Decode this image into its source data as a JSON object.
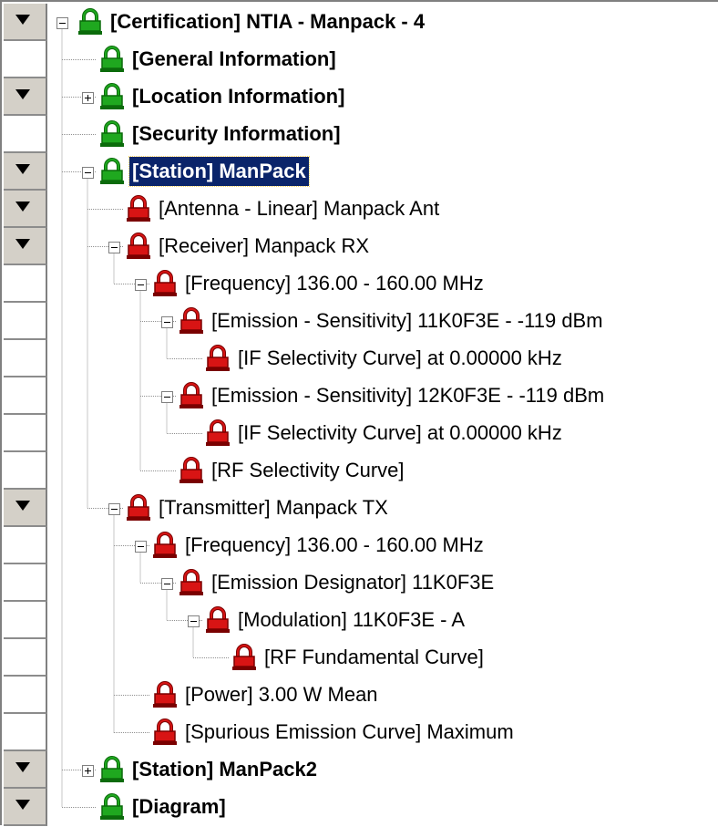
{
  "tree": {
    "nodes": [
      {
        "label": "[Certification] NTIA - Manpack - 4",
        "depth": 0,
        "bold": true,
        "lock": "green",
        "expander": "minus",
        "dropdown": true
      },
      {
        "label": "[General Information]",
        "depth": 1,
        "bold": true,
        "lock": "green",
        "expander": null,
        "dropdown": false
      },
      {
        "label": "[Location Information]",
        "depth": 1,
        "bold": true,
        "lock": "green",
        "expander": "plus",
        "dropdown": true
      },
      {
        "label": "[Security Information]",
        "depth": 1,
        "bold": true,
        "lock": "green",
        "expander": null,
        "dropdown": false
      },
      {
        "label": "[Station] ManPack",
        "depth": 1,
        "bold": true,
        "lock": "green",
        "expander": "minus",
        "dropdown": true,
        "selected": true
      },
      {
        "label": "[Antenna - Linear] Manpack Ant",
        "depth": 2,
        "bold": false,
        "lock": "red",
        "expander": null,
        "dropdown": true
      },
      {
        "label": "[Receiver] Manpack RX",
        "depth": 2,
        "bold": false,
        "lock": "red",
        "expander": "minus",
        "dropdown": true
      },
      {
        "label": "[Frequency] 136.00 - 160.00 MHz",
        "depth": 3,
        "bold": false,
        "lock": "red",
        "expander": "minus",
        "dropdown": false
      },
      {
        "label": "[Emission - Sensitivity] 11K0F3E - -119 dBm",
        "depth": 4,
        "bold": false,
        "lock": "red",
        "expander": "minus",
        "dropdown": false
      },
      {
        "label": "[IF Selectivity Curve] at 0.00000 kHz",
        "depth": 5,
        "bold": false,
        "lock": "red",
        "expander": null,
        "dropdown": false
      },
      {
        "label": "[Emission - Sensitivity] 12K0F3E - -119 dBm",
        "depth": 4,
        "bold": false,
        "lock": "red",
        "expander": "minus",
        "dropdown": false
      },
      {
        "label": "[IF Selectivity Curve] at 0.00000 kHz",
        "depth": 5,
        "bold": false,
        "lock": "red",
        "expander": null,
        "dropdown": false
      },
      {
        "label": "[RF Selectivity Curve]",
        "depth": 4,
        "bold": false,
        "lock": "red",
        "expander": null,
        "dropdown": false
      },
      {
        "label": "[Transmitter] Manpack TX",
        "depth": 2,
        "bold": false,
        "lock": "red",
        "expander": "minus",
        "dropdown": true
      },
      {
        "label": "[Frequency] 136.00 - 160.00 MHz",
        "depth": 3,
        "bold": false,
        "lock": "red",
        "expander": "minus",
        "dropdown": false
      },
      {
        "label": "[Emission Designator] 11K0F3E",
        "depth": 4,
        "bold": false,
        "lock": "red",
        "expander": "minus",
        "dropdown": false
      },
      {
        "label": "[Modulation] 11K0F3E - A",
        "depth": 5,
        "bold": false,
        "lock": "red",
        "expander": "minus",
        "dropdown": false
      },
      {
        "label": "[RF Fundamental Curve]",
        "depth": 6,
        "bold": false,
        "lock": "red",
        "expander": null,
        "dropdown": false
      },
      {
        "label": "[Power] 3.00 W Mean",
        "depth": 3,
        "bold": false,
        "lock": "red",
        "expander": null,
        "dropdown": false
      },
      {
        "label": "[Spurious Emission Curve] Maximum",
        "depth": 3,
        "bold": false,
        "lock": "red",
        "expander": null,
        "dropdown": false
      },
      {
        "label": "[Station] ManPack2",
        "depth": 1,
        "bold": true,
        "lock": "green",
        "expander": "plus",
        "dropdown": true
      },
      {
        "label": "[Diagram]",
        "depth": 1,
        "bold": true,
        "lock": "green",
        "expander": null,
        "dropdown": true
      }
    ]
  },
  "colors": {
    "selection": "#0a246a",
    "lock_green": "#1fa81f",
    "lock_red": "#d81414",
    "gutter_button": "#d4d0c8"
  }
}
